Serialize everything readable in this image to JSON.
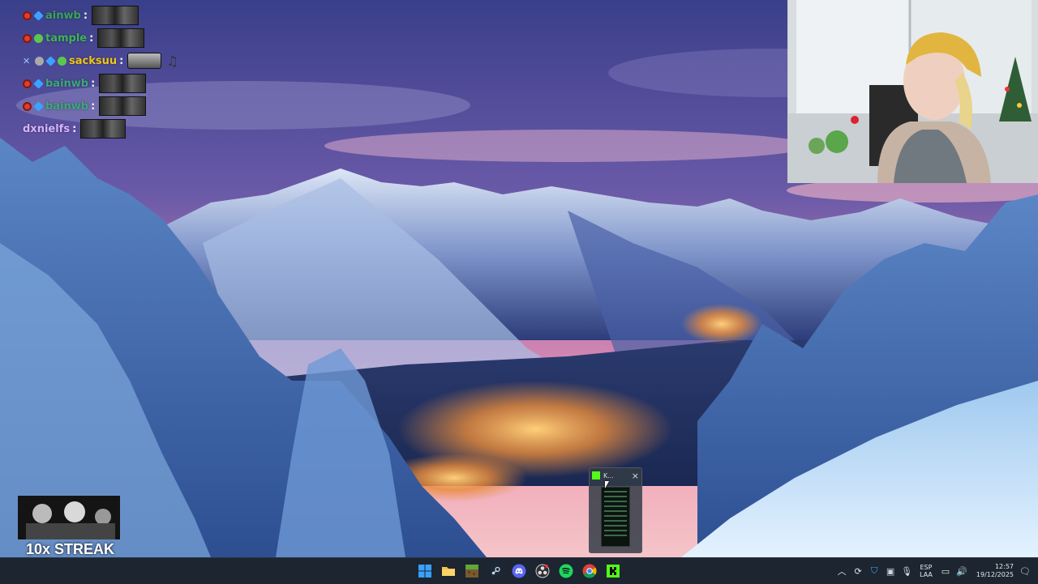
{
  "colors": {
    "taskbar_bg": "#1c2530",
    "chat_user_colors": [
      "#2ecc71",
      "#27ae60",
      "#f1c40f",
      "#3498db",
      "#3498db",
      "#cfa6ff"
    ]
  },
  "chat": {
    "messages": [
      {
        "user": "bainwb",
        "display": "ainwb",
        "color": "#3aa35c",
        "badges": [
          "red-badge",
          "cube-badge"
        ],
        "emote": "emote-gif"
      },
      {
        "user": "tample",
        "display": "tample",
        "color": "#3fb45a",
        "badges": [
          "red-badge",
          "green-badge"
        ],
        "emote": "emote-gif"
      },
      {
        "user": "sacksuu",
        "display": "sacksuu",
        "color": "#f0c419",
        "badges": [
          "tool-badge",
          "gray-badge",
          "cube-badge",
          "green-badge"
        ],
        "emote": "cat-emote"
      },
      {
        "user": "bainwb",
        "display": "bainwb",
        "color": "#3ba87c",
        "badges": [
          "red-badge",
          "cube-badge"
        ],
        "emote": "emote-gif"
      },
      {
        "user": "bainwb",
        "display": "bainwb",
        "color": "#3ba87c",
        "badges": [
          "red-badge",
          "cube-badge"
        ],
        "emote": "emote-gif"
      },
      {
        "user": "dxnielfs",
        "display": "dxnielfs",
        "color": "#d7b3ff",
        "badges": [],
        "emote": "emote-gif"
      }
    ],
    "colon": ":"
  },
  "streak": {
    "label": "10x STREAK"
  },
  "popup": {
    "title": "K...",
    "close": "×"
  },
  "taskbar": {
    "apps": [
      {
        "name": "windows-start",
        "icon": "windows-logo-icon"
      },
      {
        "name": "file-explorer",
        "icon": "folder-icon"
      },
      {
        "name": "minecraft",
        "icon": "minecraft-icon"
      },
      {
        "name": "steam",
        "icon": "steam-icon"
      },
      {
        "name": "discord",
        "icon": "discord-icon"
      },
      {
        "name": "obs",
        "icon": "obs-icon"
      },
      {
        "name": "spotify",
        "icon": "spotify-icon"
      },
      {
        "name": "chrome",
        "icon": "chrome-icon"
      },
      {
        "name": "kick",
        "icon": "kick-icon"
      }
    ],
    "tray": {
      "lang_top": "ESP",
      "lang_bottom": "LAA",
      "time": "12:57",
      "date": "19/12/2025"
    }
  }
}
